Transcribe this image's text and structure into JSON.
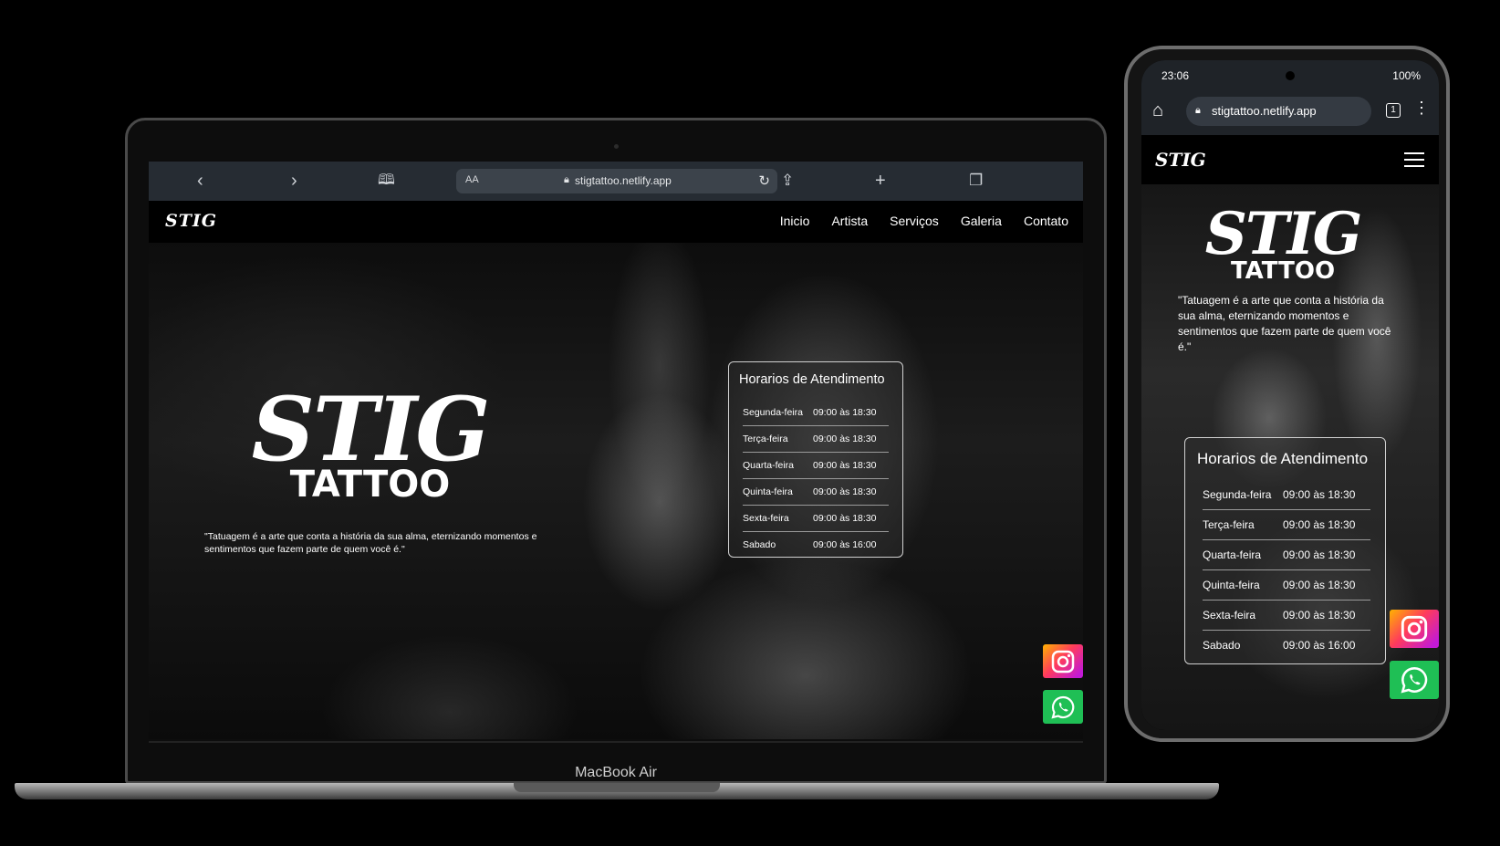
{
  "laptop": {
    "device_label": "MacBook Air",
    "browser": {
      "text_size_label": "AA",
      "url": "stigtattoo.netlify.app",
      "back_icon": "chevron-left-icon",
      "forward_icon": "chevron-right-icon",
      "bookmarks_icon": "book-icon",
      "reload_icon": "reload-icon",
      "share_icon": "share-icon",
      "new_tab_icon": "plus-icon",
      "tabs_icon": "tabs-icon"
    }
  },
  "site": {
    "logo": "STIG",
    "nav": [
      "Inicio",
      "Artista",
      "Serviços",
      "Galeria",
      "Contato"
    ],
    "hero": {
      "title": "STIG",
      "subtitle": "TATTOO",
      "quote": "\"Tatuagem é a arte que conta a história da sua alma, eternizando momentos e sentimentos que fazem parte de quem você é.\""
    },
    "hours": {
      "title": "Horarios de Atendimento",
      "rows": [
        {
          "day": "Segunda-feira",
          "time": "09:00 às 18:30"
        },
        {
          "day": "Terça-feira",
          "time": "09:00 às 18:30"
        },
        {
          "day": "Quarta-feira",
          "time": "09:00 às 18:30"
        },
        {
          "day": "Quinta-feira",
          "time": "09:00 às 18:30"
        },
        {
          "day": "Sexta-feira",
          "time": "09:00 às 18:30"
        },
        {
          "day": "Sabado",
          "time": "09:00 às 16:00"
        }
      ]
    },
    "social": {
      "instagram_icon": "instagram-icon",
      "whatsapp_icon": "whatsapp-icon",
      "instagram_color": "#e1306c",
      "whatsapp_color": "#1fbf55"
    }
  },
  "phone": {
    "status": {
      "time": "23:06",
      "battery": "100%"
    },
    "browser": {
      "url": "stigtattoo.netlify.app",
      "tab_count": "1"
    }
  }
}
